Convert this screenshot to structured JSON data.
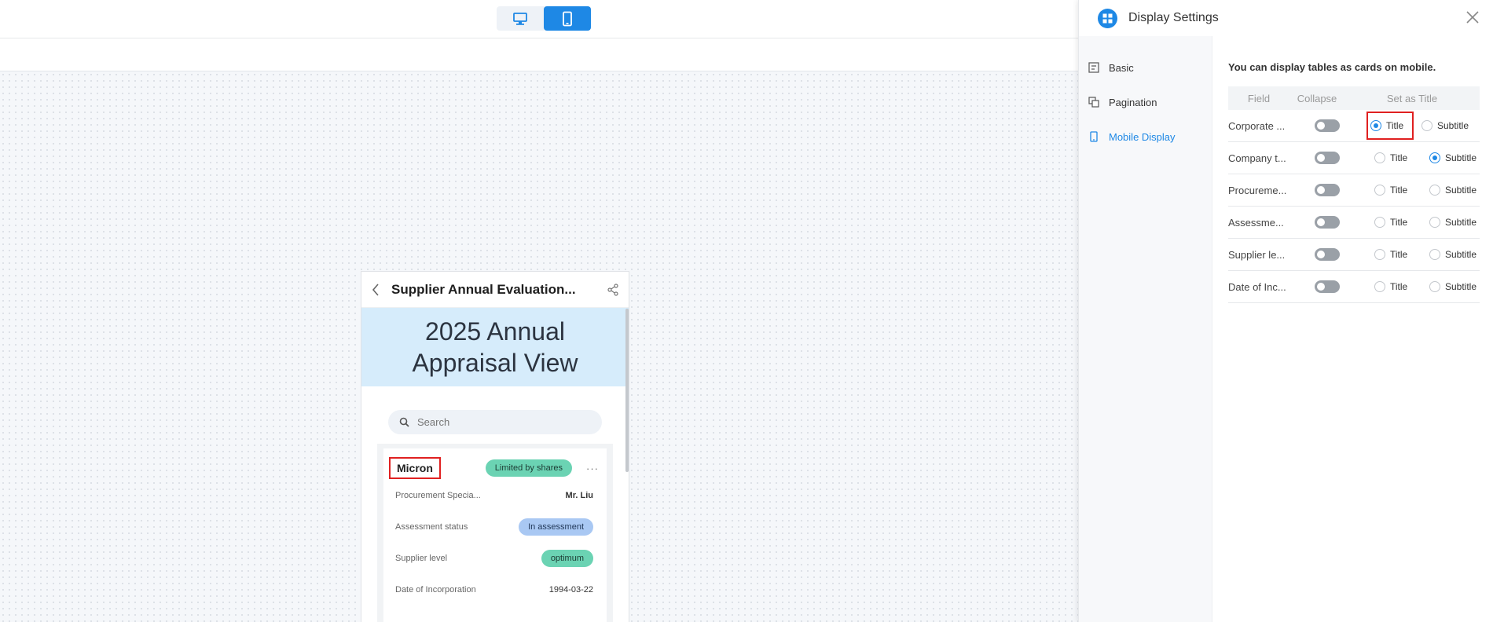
{
  "toolbar": {
    "desktop_label": "desktop-icon",
    "mobile_label": "mobile-icon"
  },
  "phone": {
    "title": "Supplier Annual Evaluation...",
    "banner": "2025 Annual Appraisal View",
    "search_placeholder": "Search",
    "card": {
      "title": "Micron",
      "company_type": "Limited by shares",
      "rows": [
        {
          "label": "Procurement Specia...",
          "value": "Mr. Liu"
        },
        {
          "label": "Assessment status",
          "value": "In assessment"
        },
        {
          "label": "Supplier level",
          "value": "optimum"
        },
        {
          "label": "Date of Incorporation",
          "value": "1994-03-22"
        }
      ]
    }
  },
  "panel": {
    "title": "Display Settings",
    "nav": [
      {
        "label": "Basic"
      },
      {
        "label": "Pagination"
      },
      {
        "label": "Mobile Display"
      }
    ],
    "hint": "You can display tables as cards on mobile.",
    "columns": {
      "field": "Field",
      "collapse": "Collapse",
      "set_as_title": "Set as Title"
    },
    "radio_labels": {
      "title": "Title",
      "subtitle": "Subtitle"
    },
    "fields": [
      {
        "name": "Corporate ...",
        "selected": "title"
      },
      {
        "name": "Company t...",
        "selected": "subtitle"
      },
      {
        "name": "Procureme...",
        "selected": "none"
      },
      {
        "name": "Assessme...",
        "selected": "none"
      },
      {
        "name": "Supplier le...",
        "selected": "none"
      },
      {
        "name": "Date of Inc...",
        "selected": "none"
      }
    ]
  },
  "colors": {
    "accent": "#1e88e5",
    "highlight": "#e02020",
    "tag_green": "#6bd3b3",
    "tag_blue": "#a9c8f3"
  }
}
